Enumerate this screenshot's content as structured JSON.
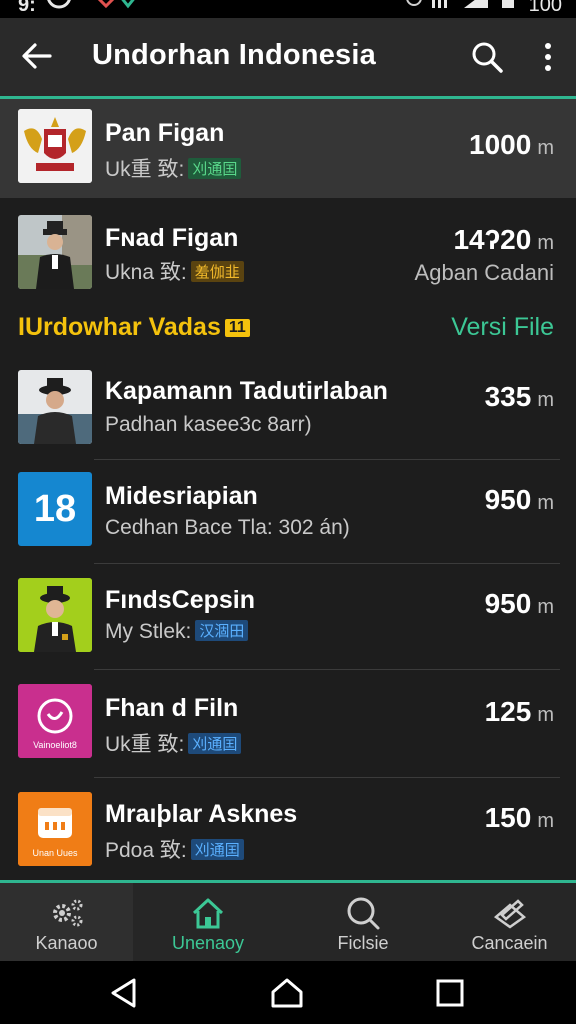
{
  "status_bar": {
    "time": "9:",
    "battery": "100"
  },
  "app_bar": {
    "title": "Undorhan Indonesia",
    "back_icon": "arrow-left-icon",
    "search_icon": "search-icon",
    "more_icon": "more-vert-icon"
  },
  "top_items": [
    {
      "name": "Pan Figan",
      "sub": "Uk重 致:",
      "tag": "刈通囯",
      "value": "1000",
      "unit": "m",
      "extra": ""
    },
    {
      "name": "Fɴad Figan",
      "sub": "Ukna 致:",
      "tag": "羞伽韭",
      "value": "14ʔ20",
      "unit": "m",
      "extra": "Aɡban Cadani"
    }
  ],
  "section": {
    "title": "IUrdowhar Vadas",
    "badge": "11",
    "link": "Versi File"
  },
  "items": [
    {
      "name": "Kapamann Tadutirlaban",
      "sub": "Padhan kasee3c 8arr)",
      "tag": "",
      "value": "335",
      "unit": "m",
      "thumb_text": ""
    },
    {
      "name": "Midesriapian",
      "sub": "Cedhan Bace Tla: 302 án)",
      "tag": "",
      "value": "950",
      "unit": "m",
      "thumb_text": "18"
    },
    {
      "name": "FındsCepsin",
      "sub": "My Stlek:",
      "tag": "汉涸田",
      "value": "950",
      "unit": "m",
      "thumb_text": ""
    },
    {
      "name": "Fhan d Filn",
      "sub": "Uk重 致:",
      "tag": "刈通囯",
      "value": "125",
      "unit": "m",
      "thumb_text": "Vainoeliot8"
    },
    {
      "name": "Mraıþlar Asknes",
      "sub": "Pdoa 致:",
      "tag": "刈通囯",
      "value": "150",
      "unit": "m",
      "thumb_text": "Unan Uues"
    }
  ],
  "bottom_nav": [
    {
      "label": "Kanaoo",
      "icon": "settings-gears-icon"
    },
    {
      "label": "Unenaoy",
      "icon": "home-icon"
    },
    {
      "label": "Ficlsie",
      "icon": "search-icon"
    },
    {
      "label": "Cancaein",
      "icon": "edit-icon"
    }
  ],
  "colors": {
    "accent": "#2fb690",
    "section": "#f4c20d",
    "link": "#3cc795",
    "background": "#1d1d1d"
  }
}
